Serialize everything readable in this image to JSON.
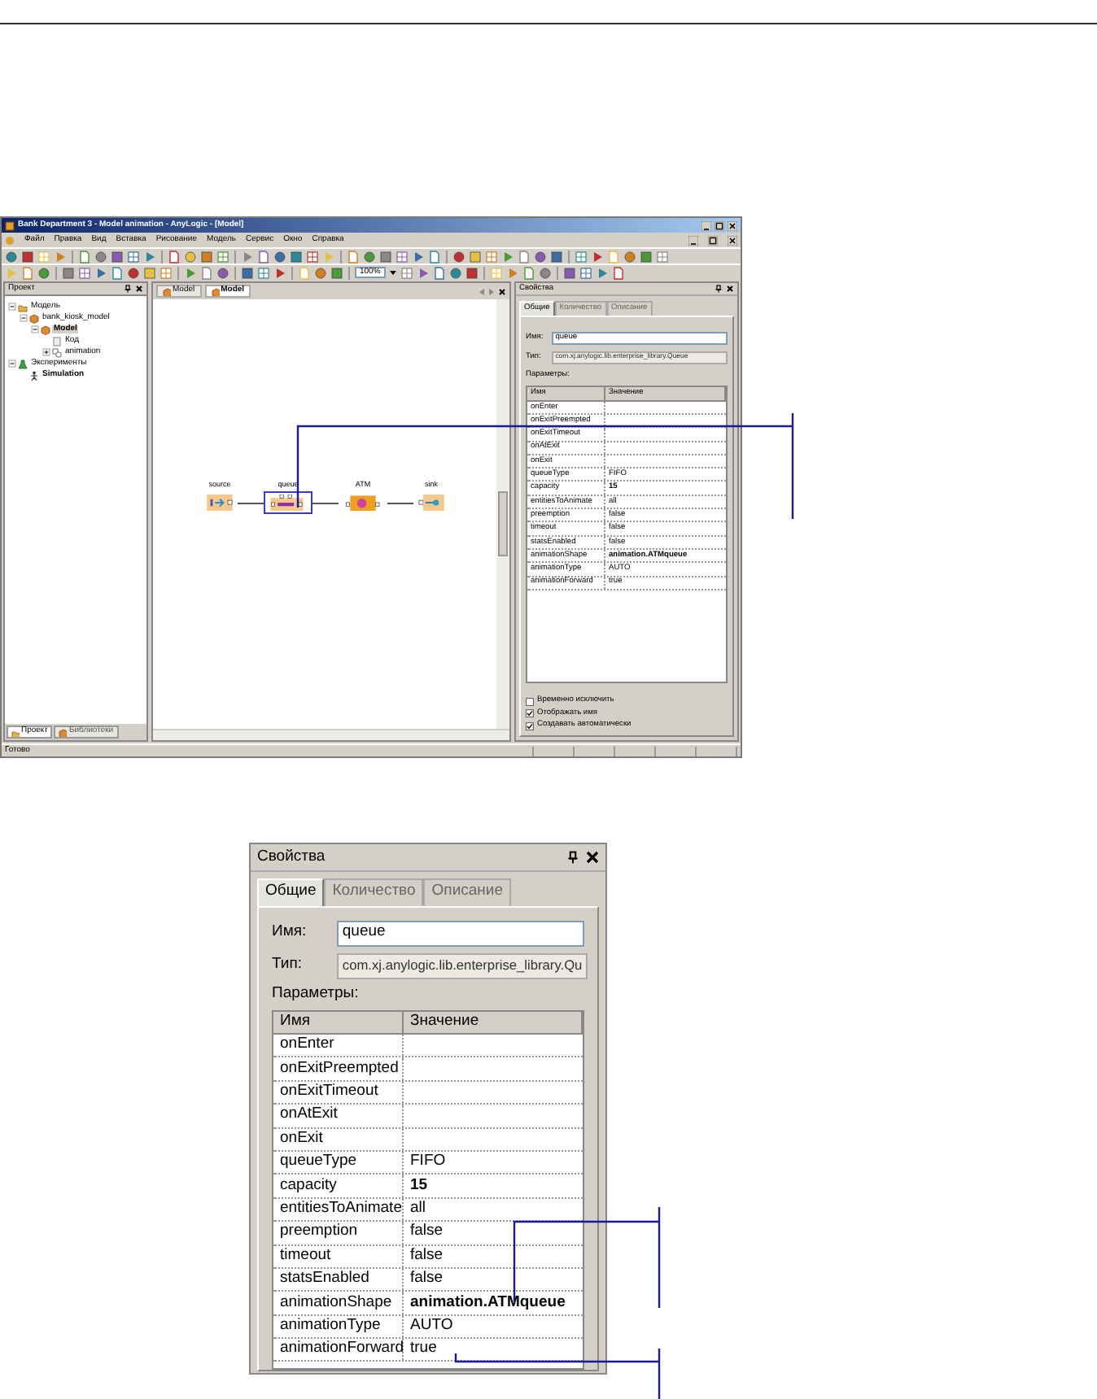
{
  "app_window": {
    "title": "Bank Department 3 - Model animation - AnyLogic - [Model]",
    "menu": [
      "Файл",
      "Правка",
      "Вид",
      "Вставка",
      "Рисование",
      "Модель",
      "Сервис",
      "Окно",
      "Справка"
    ],
    "toolbar": {
      "zoom": "100%"
    },
    "project_panel": {
      "title": "Проект",
      "tree": [
        {
          "label": "Модель",
          "kind": "folder",
          "expanded": true,
          "selected": false,
          "bold": false,
          "children": [
            {
              "label": "bank_kiosk_model",
              "kind": "class",
              "expanded": true,
              "selected": false,
              "bold": false,
              "children": [
                {
                  "label": "Model",
                  "kind": "class",
                  "expanded": true,
                  "selected": true,
                  "bold": true,
                  "children": [
                    {
                      "label": "Код",
                      "kind": "code",
                      "selected": false,
                      "bold": false
                    },
                    {
                      "label": "animation",
                      "kind": "presentation",
                      "expanded": false,
                      "selected": false,
                      "bold": false
                    }
                  ]
                }
              ]
            }
          ]
        },
        {
          "label": "Эксперименты",
          "kind": "experiments",
          "expanded": true,
          "selected": false,
          "bold": false,
          "children": [
            {
              "label": "Simulation",
              "kind": "experiment",
              "selected": false,
              "bold": true
            }
          ]
        }
      ],
      "tabs": [
        {
          "label": "Проект",
          "selected": true
        },
        {
          "label": "Библиотеки",
          "selected": false
        }
      ]
    },
    "editor": {
      "tabs": [
        {
          "label": "Model",
          "selected": false
        },
        {
          "label": "Model",
          "selected": true
        }
      ],
      "nodes": [
        {
          "label": "source",
          "kind": "source",
          "selected": false
        },
        {
          "label": "queue",
          "kind": "queue",
          "selected": true
        },
        {
          "label": "ATM",
          "kind": "service",
          "selected": false
        },
        {
          "label": "sink",
          "kind": "sink",
          "selected": false
        }
      ]
    },
    "properties": {
      "title": "Свойства",
      "tabs": [
        {
          "label": "Общие",
          "selected": true
        },
        {
          "label": "Количество",
          "selected": false
        },
        {
          "label": "Описание",
          "selected": false
        }
      ],
      "name_label": "Имя:",
      "name_value": "queue",
      "type_label": "Тип:",
      "type_value": "com.xj.anylogic.lib.enterprise_library.Queue",
      "params_label": "Параметры:",
      "columns": [
        "Имя",
        "Значение"
      ],
      "rows": [
        {
          "name": "onEnter"
        },
        {
          "name": "onExitPreempted"
        },
        {
          "name": "onExitTimeout"
        },
        {
          "name": "onAtExit"
        },
        {
          "name": "onExit"
        },
        {
          "name": "queueType",
          "value": "FIFO",
          "bold": false
        },
        {
          "name": "capacity",
          "value": "15",
          "bold": true
        },
        {
          "name": "entitiesToAnimate",
          "value": "all",
          "bold": false
        },
        {
          "name": "preemption",
          "value": "false",
          "bold": false
        },
        {
          "name": "timeout",
          "value": "false",
          "bold": false
        },
        {
          "name": "statsEnabled",
          "value": "false",
          "bold": false
        },
        {
          "name": "animationShape",
          "value": "animation.ATMqueue",
          "bold": true
        },
        {
          "name": "animationType",
          "value": "AUTO",
          "bold": false
        },
        {
          "name": "animationForward",
          "value": "true",
          "bold": false
        }
      ],
      "options": [
        {
          "label": "Временно исключить",
          "checked": false
        },
        {
          "label": "Отображать имя",
          "checked": true
        },
        {
          "label": "Создавать автоматически",
          "checked": true
        }
      ]
    },
    "status_bar": {
      "text": "Готово"
    }
  },
  "properties_closeup": {
    "title": "Свойства",
    "tabs": [
      {
        "label": "Общие",
        "selected": true
      },
      {
        "label": "Количество",
        "selected": false
      },
      {
        "label": "Описание",
        "selected": false
      }
    ],
    "name_label": "Имя:",
    "name_value": "queue",
    "type_label": "Тип:",
    "type_value": "com.xj.anylogic.lib.enterprise_library.Qu",
    "params_label": "Параметры:",
    "columns": [
      "Имя",
      "Значение"
    ],
    "rows": [
      {
        "name": "onEnter"
      },
      {
        "name": "onExitPreempted"
      },
      {
        "name": "onExitTimeout"
      },
      {
        "name": "onAtExit"
      },
      {
        "name": "onExit"
      },
      {
        "name": "queueType",
        "value": "FIFO",
        "bold": false
      },
      {
        "name": "capacity",
        "value": "15",
        "bold": true
      },
      {
        "name": "entitiesToAnimate",
        "value": "all",
        "bold": false
      },
      {
        "name": "preemption",
        "value": "false",
        "bold": false
      },
      {
        "name": "timeout",
        "value": "false",
        "bold": false
      },
      {
        "name": "statsEnabled",
        "value": "false",
        "bold": false
      },
      {
        "name": "animationShape",
        "value": "animation.ATMqueue",
        "bold": true
      },
      {
        "name": "animationType",
        "value": "AUTO",
        "bold": false
      },
      {
        "name": "animationForward",
        "value": "true",
        "bold": false
      }
    ]
  }
}
